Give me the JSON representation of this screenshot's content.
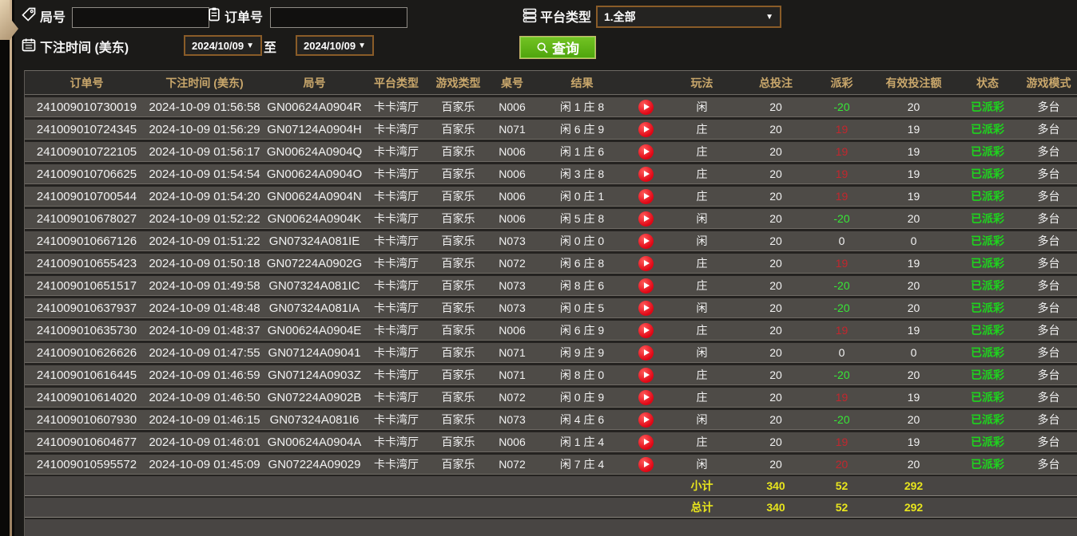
{
  "filters": {
    "round_label": "局号",
    "round_value": "",
    "order_label": "订单号",
    "order_value": "",
    "platform_label": "平台类型",
    "platform_value": "1.全部",
    "bet_time_label": "下注时间 (美东)",
    "date_from": "2024/10/09",
    "to_label": "至",
    "date_to": "2024/10/09",
    "query_label": "查询"
  },
  "icons": {
    "round_field": "tag-icon",
    "order_field": "clipboard-icon",
    "platform_field": "list-icon",
    "bet_time_field": "calendar-icon",
    "query_button": "search-icon",
    "result_cell": "play-icon",
    "dropdowns": "caret-down-icon"
  },
  "colors": {
    "header_gold": "#c9a76b",
    "totals_yellow": "#e8e51d",
    "payout_negative_green": "#37e837",
    "payout_positive_red": "#c2272e",
    "status_paid_green": "#1ed41e",
    "query_button_green": "#5bb414",
    "picker_border_brown": "#8a5c28",
    "row_gray": "#4e4b47"
  },
  "table": {
    "headers": [
      "订单号",
      "下注时间 (美东)",
      "局号",
      "平台类型",
      "游戏类型",
      "桌号",
      "结果",
      "",
      "玩法",
      "总投注",
      "派彩",
      "有效投注额",
      "状态",
      "游戏模式"
    ],
    "rows": [
      {
        "order": "241009010730019",
        "time": "2024-10-09 01:56:58",
        "round": "GN00624A0904R",
        "platform": "卡卡湾厅",
        "game": "百家乐",
        "table": "N006",
        "result": "闲 1 庄 8",
        "side": "闲",
        "total": "20",
        "payout": "-20",
        "payout_color": "green",
        "valid": "20",
        "status": "已派彩",
        "mode": "多台"
      },
      {
        "order": "241009010724345",
        "time": "2024-10-09 01:56:29",
        "round": "GN07124A0904H",
        "platform": "卡卡湾厅",
        "game": "百家乐",
        "table": "N071",
        "result": "闲 6 庄 9",
        "side": "庄",
        "total": "20",
        "payout": "19",
        "payout_color": "red",
        "valid": "19",
        "status": "已派彩",
        "mode": "多台"
      },
      {
        "order": "241009010722105",
        "time": "2024-10-09 01:56:17",
        "round": "GN00624A0904Q",
        "platform": "卡卡湾厅",
        "game": "百家乐",
        "table": "N006",
        "result": "闲 1 庄 6",
        "side": "庄",
        "total": "20",
        "payout": "19",
        "payout_color": "red",
        "valid": "19",
        "status": "已派彩",
        "mode": "多台"
      },
      {
        "order": "241009010706625",
        "time": "2024-10-09 01:54:54",
        "round": "GN00624A0904O",
        "platform": "卡卡湾厅",
        "game": "百家乐",
        "table": "N006",
        "result": "闲 3 庄 8",
        "side": "庄",
        "total": "20",
        "payout": "19",
        "payout_color": "red",
        "valid": "19",
        "status": "已派彩",
        "mode": "多台"
      },
      {
        "order": "241009010700544",
        "time": "2024-10-09 01:54:20",
        "round": "GN00624A0904N",
        "platform": "卡卡湾厅",
        "game": "百家乐",
        "table": "N006",
        "result": "闲 0 庄 1",
        "side": "庄",
        "total": "20",
        "payout": "19",
        "payout_color": "red",
        "valid": "19",
        "status": "已派彩",
        "mode": "多台"
      },
      {
        "order": "241009010678027",
        "time": "2024-10-09 01:52:22",
        "round": "GN00624A0904K",
        "platform": "卡卡湾厅",
        "game": "百家乐",
        "table": "N006",
        "result": "闲 5 庄 8",
        "side": "闲",
        "total": "20",
        "payout": "-20",
        "payout_color": "green",
        "valid": "20",
        "status": "已派彩",
        "mode": "多台"
      },
      {
        "order": "241009010667126",
        "time": "2024-10-09 01:51:22",
        "round": "GN07324A081IE",
        "platform": "卡卡湾厅",
        "game": "百家乐",
        "table": "N073",
        "result": "闲 0 庄 0",
        "side": "闲",
        "total": "20",
        "payout": "0",
        "payout_color": "neutral",
        "valid": "0",
        "status": "已派彩",
        "mode": "多台"
      },
      {
        "order": "241009010655423",
        "time": "2024-10-09 01:50:18",
        "round": "GN07224A0902G",
        "platform": "卡卡湾厅",
        "game": "百家乐",
        "table": "N072",
        "result": "闲 6 庄 8",
        "side": "庄",
        "total": "20",
        "payout": "19",
        "payout_color": "red",
        "valid": "19",
        "status": "已派彩",
        "mode": "多台"
      },
      {
        "order": "241009010651517",
        "time": "2024-10-09 01:49:58",
        "round": "GN07324A081IC",
        "platform": "卡卡湾厅",
        "game": "百家乐",
        "table": "N073",
        "result": "闲 8 庄 6",
        "side": "庄",
        "total": "20",
        "payout": "-20",
        "payout_color": "green",
        "valid": "20",
        "status": "已派彩",
        "mode": "多台"
      },
      {
        "order": "241009010637937",
        "time": "2024-10-09 01:48:48",
        "round": "GN07324A081IA",
        "platform": "卡卡湾厅",
        "game": "百家乐",
        "table": "N073",
        "result": "闲 0 庄 5",
        "side": "闲",
        "total": "20",
        "payout": "-20",
        "payout_color": "green",
        "valid": "20",
        "status": "已派彩",
        "mode": "多台"
      },
      {
        "order": "241009010635730",
        "time": "2024-10-09 01:48:37",
        "round": "GN00624A0904E",
        "platform": "卡卡湾厅",
        "game": "百家乐",
        "table": "N006",
        "result": "闲 6 庄 9",
        "side": "庄",
        "total": "20",
        "payout": "19",
        "payout_color": "red",
        "valid": "19",
        "status": "已派彩",
        "mode": "多台"
      },
      {
        "order": "241009010626626",
        "time": "2024-10-09 01:47:55",
        "round": "GN07124A09041",
        "platform": "卡卡湾厅",
        "game": "百家乐",
        "table": "N071",
        "result": "闲 9 庄 9",
        "side": "闲",
        "total": "20",
        "payout": "0",
        "payout_color": "neutral",
        "valid": "0",
        "status": "已派彩",
        "mode": "多台"
      },
      {
        "order": "241009010616445",
        "time": "2024-10-09 01:46:59",
        "round": "GN07124A0903Z",
        "platform": "卡卡湾厅",
        "game": "百家乐",
        "table": "N071",
        "result": "闲 8 庄 0",
        "side": "庄",
        "total": "20",
        "payout": "-20",
        "payout_color": "green",
        "valid": "20",
        "status": "已派彩",
        "mode": "多台"
      },
      {
        "order": "241009010614020",
        "time": "2024-10-09 01:46:50",
        "round": "GN07224A0902B",
        "platform": "卡卡湾厅",
        "game": "百家乐",
        "table": "N072",
        "result": "闲 0 庄 9",
        "side": "庄",
        "total": "20",
        "payout": "19",
        "payout_color": "red",
        "valid": "19",
        "status": "已派彩",
        "mode": "多台"
      },
      {
        "order": "241009010607930",
        "time": "2024-10-09 01:46:15",
        "round": "GN07324A081I6",
        "platform": "卡卡湾厅",
        "game": "百家乐",
        "table": "N073",
        "result": "闲 4 庄 6",
        "side": "闲",
        "total": "20",
        "payout": "-20",
        "payout_color": "green",
        "valid": "20",
        "status": "已派彩",
        "mode": "多台"
      },
      {
        "order": "241009010604677",
        "time": "2024-10-09 01:46:01",
        "round": "GN00624A0904A",
        "platform": "卡卡湾厅",
        "game": "百家乐",
        "table": "N006",
        "result": "闲 1 庄 4",
        "side": "庄",
        "total": "20",
        "payout": "19",
        "payout_color": "red",
        "valid": "19",
        "status": "已派彩",
        "mode": "多台"
      },
      {
        "order": "241009010595572",
        "time": "2024-10-09 01:45:09",
        "round": "GN07224A09029",
        "platform": "卡卡湾厅",
        "game": "百家乐",
        "table": "N072",
        "result": "闲 7 庄 4",
        "side": "闲",
        "total": "20",
        "payout": "20",
        "payout_color": "red",
        "valid": "20",
        "status": "已派彩",
        "mode": "多台"
      }
    ],
    "subtotal": {
      "label": "小计",
      "total": "340",
      "payout": "52",
      "valid": "292"
    },
    "grand_total": {
      "label": "总计",
      "total": "340",
      "payout": "52",
      "valid": "292"
    }
  }
}
